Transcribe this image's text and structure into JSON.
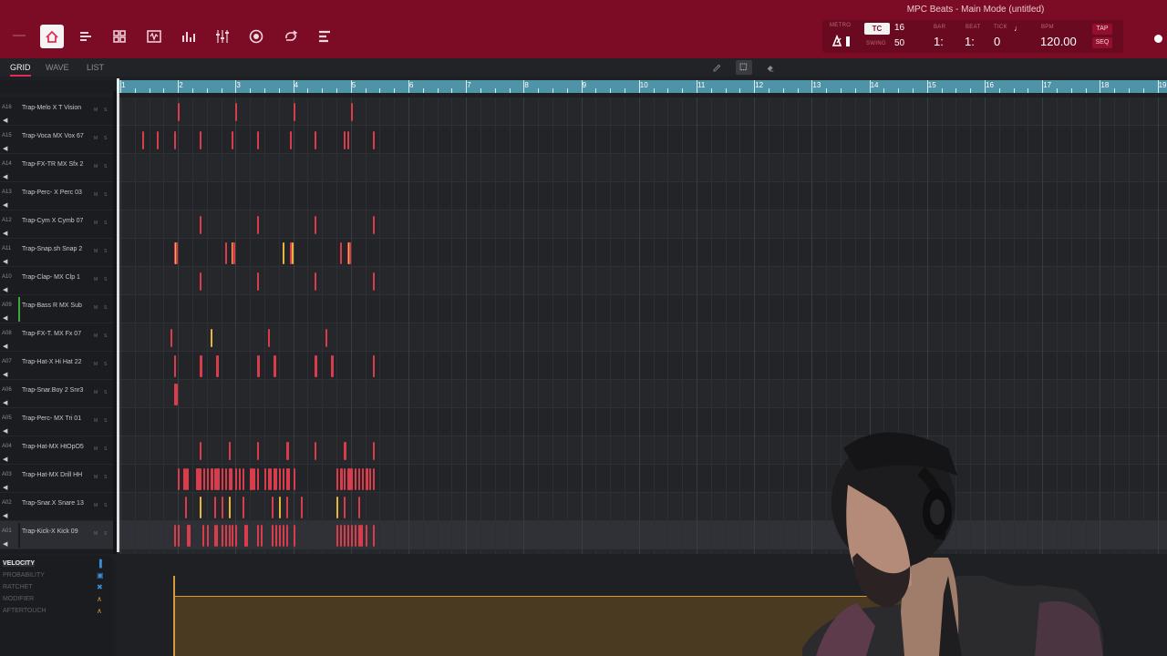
{
  "window_title": "MPC Beats - Main Mode (untitled)",
  "toolbar": [
    {
      "name": "home-icon",
      "active": true
    },
    {
      "name": "list-view-icon",
      "active": false
    },
    {
      "name": "pad-grid-icon",
      "active": false
    },
    {
      "name": "sample-edit-icon",
      "active": false
    },
    {
      "name": "mixer-bars-icon",
      "active": false
    },
    {
      "name": "mixer-sliders-icon",
      "active": false
    },
    {
      "name": "record-circle-icon",
      "active": false
    },
    {
      "name": "looper-icon",
      "active": false
    },
    {
      "name": "browser-icon",
      "active": false
    }
  ],
  "transport": {
    "metro_label": "METRO",
    "tc_label": "TC",
    "tc_value": "16",
    "swing_label": "SWING",
    "swing_value": "50",
    "bar_label": "BAR",
    "beat_label": "BEAT",
    "tick_label": "TICK",
    "bpm_label": "BPM",
    "bar_value": "1:",
    "beat_value": "1:",
    "tick_value": "0",
    "bpm_value": "120.00",
    "tap_label": "TAP",
    "seq_label": "SEQ"
  },
  "view_tabs": [
    {
      "label": "GRID",
      "active": true
    },
    {
      "label": "WAVE",
      "active": false
    },
    {
      "label": "LIST",
      "active": false
    }
  ],
  "edit_tools": [
    {
      "name": "pencil-icon",
      "active": false
    },
    {
      "name": "select-box-icon",
      "active": true
    },
    {
      "name": "eraser-icon",
      "active": false
    }
  ],
  "ruler": {
    "bars": [
      "1",
      "2",
      "3",
      "4",
      "5",
      "6",
      "7",
      "8",
      "9",
      "10",
      "11",
      "12",
      "13",
      "14",
      "15",
      "16",
      "17",
      "18",
      "19"
    ]
  },
  "tracks": [
    {
      "pad": "A16",
      "name": "Trap-Melo X T Vision",
      "color": "#1b1c1f"
    },
    {
      "pad": "A15",
      "name": "Trap-Voca MX Vox 67",
      "color": "#1b1c1f"
    },
    {
      "pad": "A14",
      "name": "Trap-FX-TR MX Sfx 2",
      "color": "#1b1c1f"
    },
    {
      "pad": "A13",
      "name": "Trap-Perc- X Perc 03",
      "color": "#1b1c1f"
    },
    {
      "pad": "A12",
      "name": "Trap-Cym X Cymb 07",
      "color": "#1b1c1f"
    },
    {
      "pad": "A11",
      "name": "Trap-Snap.sh Snap 2",
      "color": "#1b1c1f"
    },
    {
      "pad": "A10",
      "name": "Trap-Clap- MX Clp 1",
      "color": "#1b1c1f"
    },
    {
      "pad": "A09",
      "name": "Trap-Bass R MX Sub",
      "color": "#3ea83a"
    },
    {
      "pad": "A08",
      "name": "Trap-FX-T. MX Fx 07",
      "color": "#1b1c1f"
    },
    {
      "pad": "A07",
      "name": "Trap-Hat-X Hi Hat 22",
      "color": "#1b1c1f"
    },
    {
      "pad": "A06",
      "name": "Trap-Snar.Boy 2 Snr3",
      "color": "#1b1c1f"
    },
    {
      "pad": "A05",
      "name": "Trap-Perc- MX Tri 01",
      "color": "#1b1c1f"
    },
    {
      "pad": "A04",
      "name": "Trap-Hat-MX HtOpO5",
      "color": "#1b1c1f"
    },
    {
      "pad": "A03",
      "name": "Trap-Hat-MX Drill HH",
      "color": "#1b1c1f"
    },
    {
      "pad": "A02",
      "name": "Trap-Snar.X Snare 13",
      "color": "#1b1c1f"
    },
    {
      "pad": "A01",
      "name": "Trap-Kick-X Kick 09",
      "color": "#1b1c1f",
      "selected": true
    }
  ],
  "lanes": [
    {
      "label": "VELOCITY",
      "active": true,
      "icon": "velocity-bars-icon"
    },
    {
      "label": "PROBABILITY",
      "active": false,
      "icon": "probability-icon"
    },
    {
      "label": "RATCHET",
      "active": false,
      "icon": "ratchet-icon"
    },
    {
      "label": "MODIFIER",
      "active": false,
      "icon": "modifier-icon"
    },
    {
      "label": "AFTERTOUCH",
      "active": false,
      "icon": "aftertouch-icon"
    }
  ],
  "colors": {
    "title_bar": "#7c0c26",
    "ruler": "#4e93a6",
    "note_red": "#d93c4a",
    "note_yellow": "#e6b63c",
    "velocity": "#d49a3c"
  },
  "note_pattern": {
    "beats_per_bar": 4,
    "note_width_beats": 0.06,
    "rows": [
      {
        "row": 0,
        "color": "red",
        "beats": [
          4.0,
          8.0,
          12.0,
          16.0
        ]
      },
      {
        "row": 1,
        "color": "red",
        "beats": [
          1.5,
          2.5,
          3.75,
          5.5,
          7.75,
          9.5,
          11.75,
          13.5,
          15.5,
          15.75,
          17.5
        ]
      },
      {
        "row": 4,
        "color": "red",
        "beats": [
          5.5,
          9.5,
          13.5,
          17.5
        ]
      },
      {
        "row": 5,
        "color": "mix",
        "beats": [
          3.75,
          3.8,
          3.87,
          7.25,
          7.75,
          7.8,
          7.87,
          11.25,
          11.75,
          11.8,
          11.87,
          15.25,
          15.75,
          15.8,
          15.87
        ]
      },
      {
        "row": 6,
        "color": "red",
        "beats": [
          5.5,
          9.5,
          13.5,
          17.5
        ]
      },
      {
        "row": 8,
        "color": "mix",
        "beats": [
          3.5,
          6.25,
          10.25,
          14.25
        ]
      },
      {
        "row": 9,
        "color": "red",
        "beats": [
          3.75,
          5.5,
          5.56,
          6.62,
          6.68,
          9.5,
          9.56,
          10.62,
          10.68,
          13.5,
          13.56,
          14.62,
          14.68,
          17.5,
          17.56
        ]
      },
      {
        "row": 10,
        "color": "red",
        "beats": [
          3.75,
          3.81,
          3.87
        ]
      },
      {
        "row": 12,
        "color": "red",
        "beats": [
          5.5,
          7.5,
          7.56,
          9.5,
          11.5,
          11.56,
          13.5,
          15.5,
          15.56,
          17.5
        ]
      },
      {
        "row": 13,
        "color": "red",
        "beats": [
          4.0,
          4.37,
          4.5,
          4.62,
          5.25,
          5.31,
          5.37,
          5.43,
          5.5,
          5.75,
          6.0,
          6.25,
          6.31,
          6.5,
          6.62,
          6.68,
          6.75,
          7.0,
          7.25,
          7.5,
          7.56,
          7.62,
          7.68,
          8.0,
          8.25,
          8.5,
          9.0,
          9.06,
          9.12,
          9.25,
          9.5,
          10.0,
          10.25,
          10.37,
          10.62,
          10.68,
          10.75,
          11.0,
          11.25,
          11.5,
          11.56,
          11.62,
          12.0,
          15.0,
          15.25,
          15.31,
          15.5,
          15.75,
          15.81,
          15.87,
          16.0,
          16.25,
          16.5,
          16.75,
          17.0,
          17.06,
          17.12,
          17.25,
          17.5
        ]
      },
      {
        "row": 14,
        "color": "mix",
        "beats": [
          4.5,
          5.5,
          6.5,
          7.0,
          7.5,
          8.5,
          10.5,
          11.0,
          11.5,
          12.5,
          15.0,
          15.5,
          16.5
        ]
      },
      {
        "row": 15,
        "color": "red",
        "beats": [
          3.75,
          4.0,
          4.62,
          4.68,
          4.75,
          5.7,
          6.0,
          6.5,
          6.62,
          7.0,
          7.25,
          7.5,
          7.75,
          8.0,
          8.62,
          8.68,
          8.75,
          9.5,
          9.75,
          10.5,
          10.75,
          11.0,
          11.25,
          11.5,
          12.0,
          15.0,
          15.25,
          15.5,
          15.75,
          16.0,
          16.25,
          16.5,
          16.62,
          16.68,
          17.0,
          17.5
        ]
      }
    ]
  },
  "velocity_lane": {
    "level": 0.7,
    "start_beat": 3.75
  }
}
